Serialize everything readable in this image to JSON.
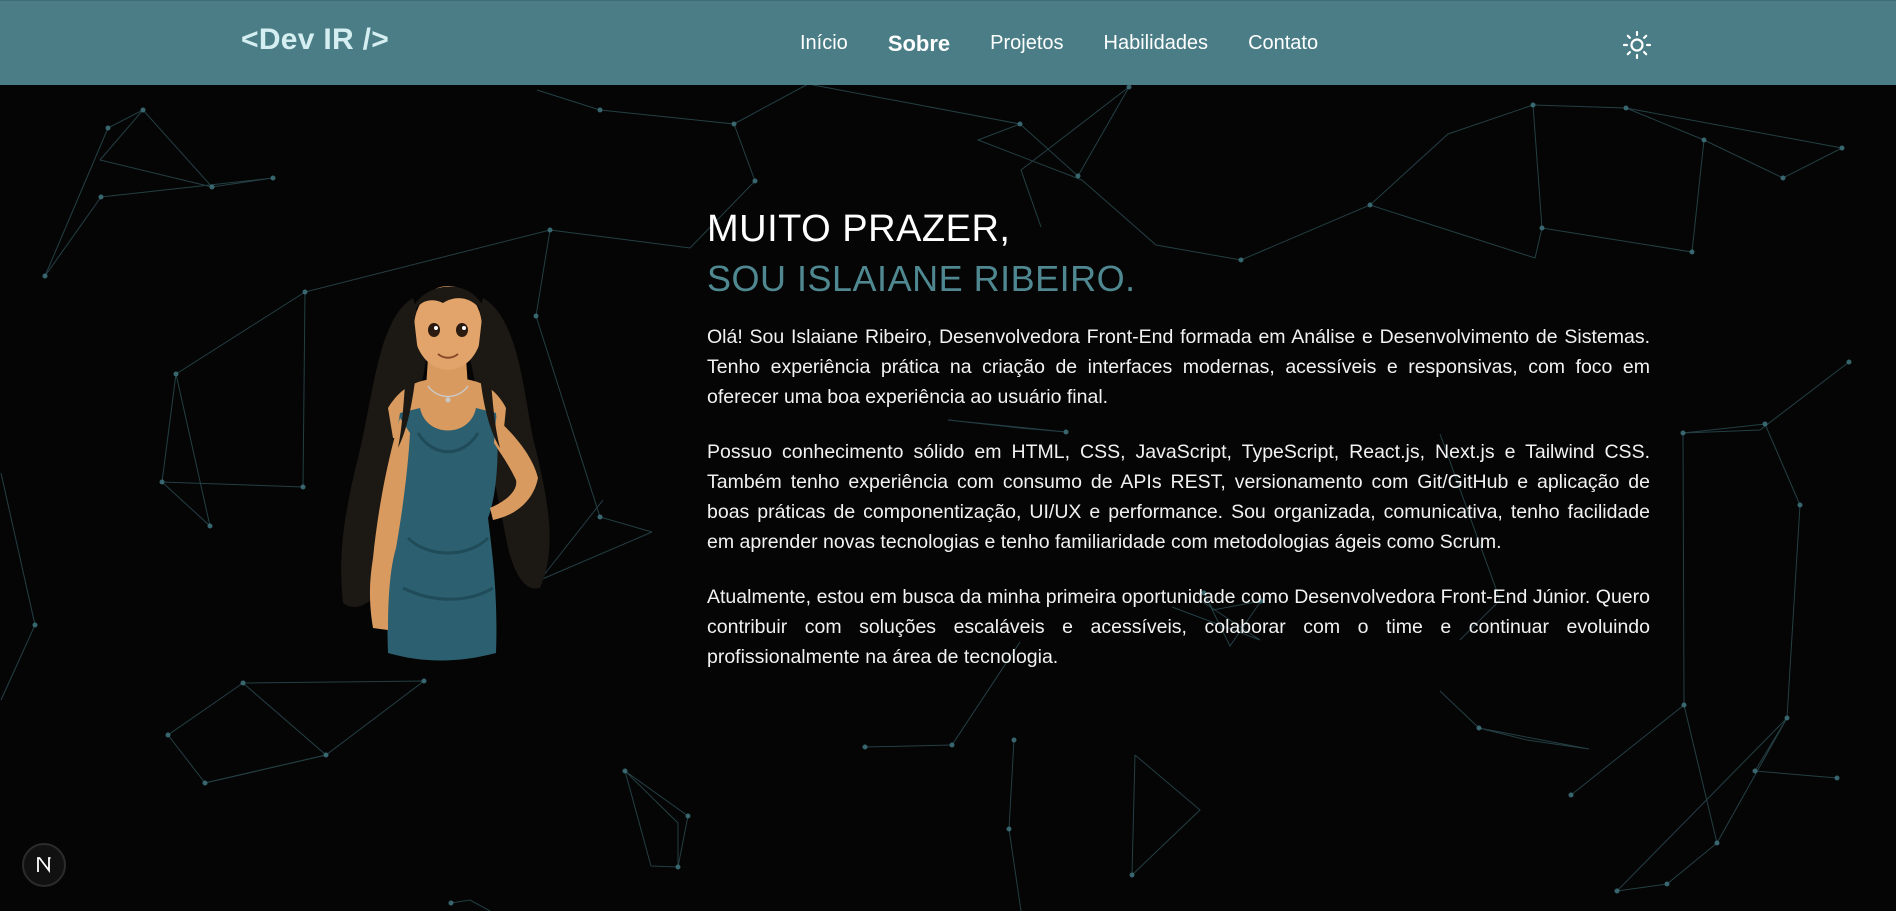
{
  "header": {
    "logo": "<Dev IR />",
    "nav": [
      {
        "label": "Início"
      },
      {
        "label": "Sobre"
      },
      {
        "label": "Projetos"
      },
      {
        "label": "Habilidades"
      },
      {
        "label": "Contato"
      }
    ],
    "active_nav": "Sobre",
    "theme_icon": "sun-icon"
  },
  "about": {
    "greeting": "MUITO PRAZER,",
    "name_line": "SOU ISLAIANE RIBEIRO.",
    "paragraphs": [
      "Olá! Sou Islaiane Ribeiro, Desenvolvedora Front-End formada em Análise e Desenvolvimento de Sistemas. Tenho experiência prática na criação de interfaces modernas, acessíveis e responsivas, com foco em oferecer uma boa experiência ao usuário final.",
      "Possuo conhecimento sólido em HTML, CSS, JavaScript, TypeScript, React.js, Next.js e Tailwind CSS. Também tenho experiência com consumo de APIs REST, versionamento com Git/GitHub e aplicação de boas práticas de componentização, UI/UX e performance. Sou organizada, comunicativa, tenho facilidade em aprender novas tecnologias e tenho familiaridade com metodologias ágeis como Scrum.",
      "Atualmente, estou em busca da minha primeira oportunidade como Desenvolvedora Front-End Júnior. Quero contribuir com soluções escaláveis e acessíveis, colaborar com o time e continuar evoluindo profissionalmente na área de tecnologia."
    ]
  },
  "badge": {
    "label": "N"
  },
  "colors": {
    "header_bg": "#4a7d86",
    "accent": "#4f8891",
    "logo": "#d5eef1",
    "page_bg": "#050505",
    "network": "#3d6f78"
  }
}
